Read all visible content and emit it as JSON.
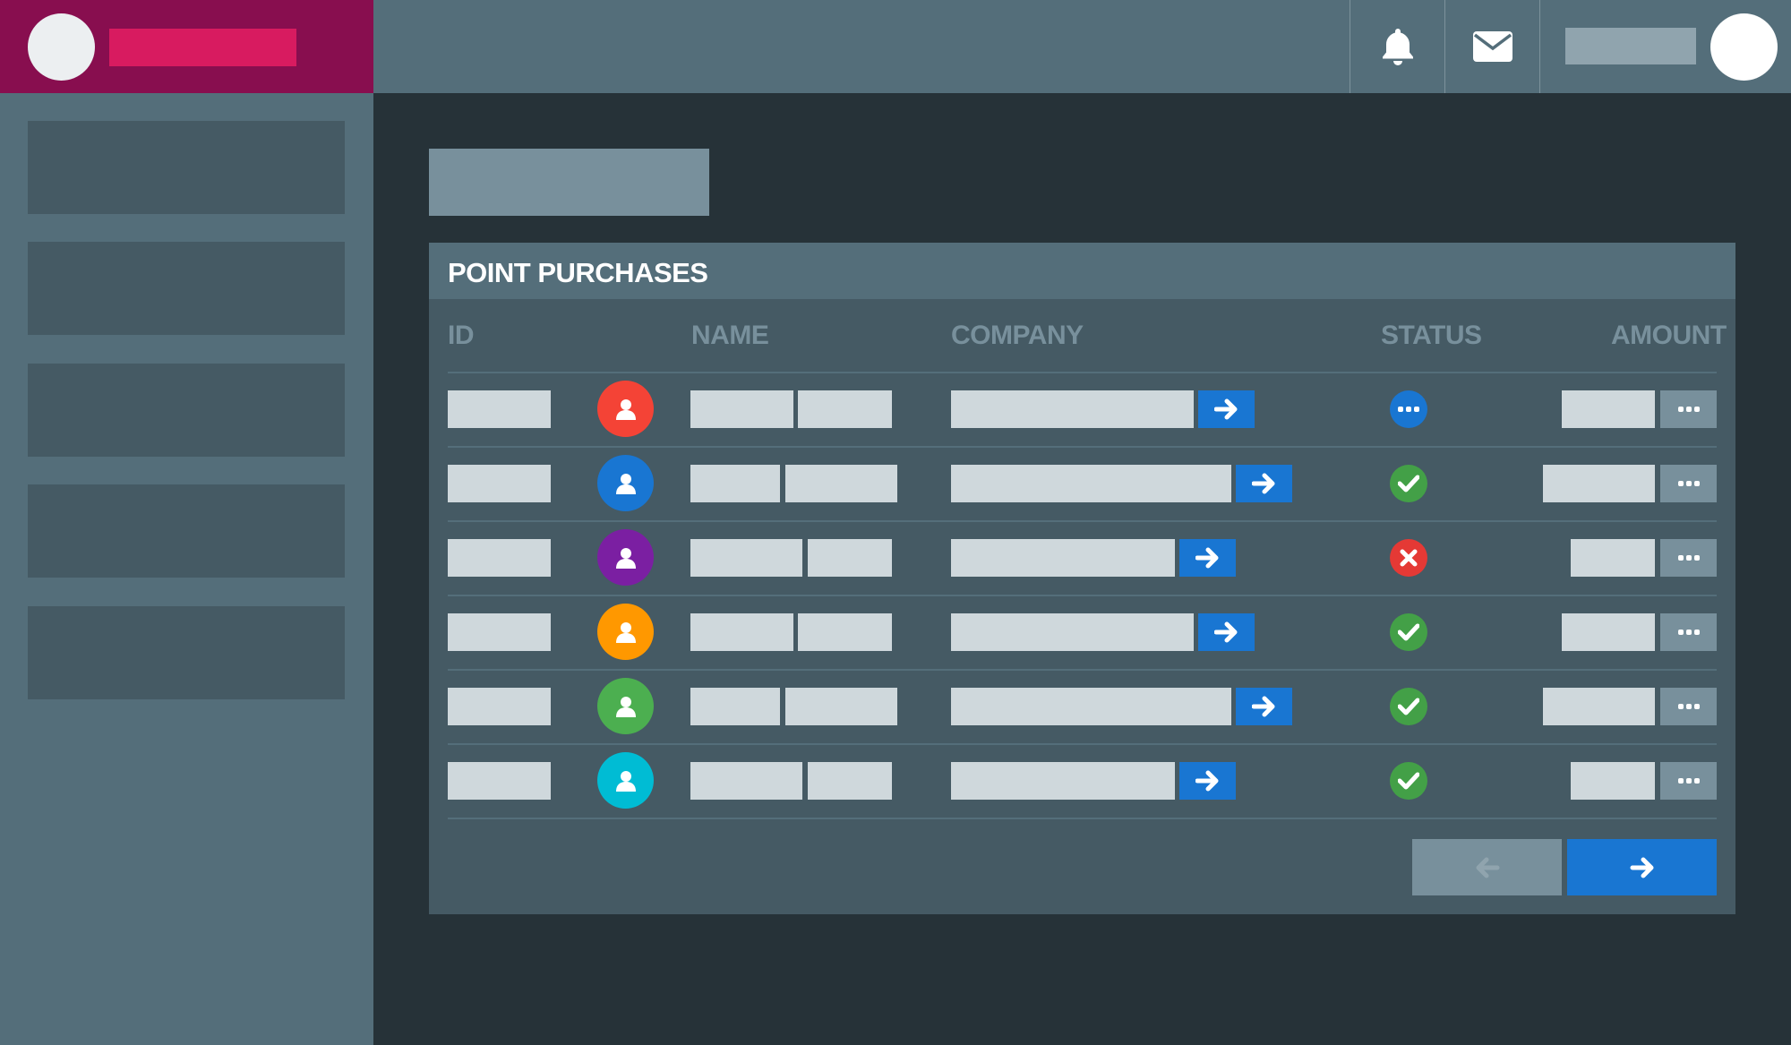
{
  "header": {
    "icons": {
      "notifications": "bell-icon",
      "messages": "mail-icon"
    }
  },
  "card": {
    "title": "POINT PURCHASES",
    "columns": {
      "id": "ID",
      "name": "NAME",
      "company": "COMPANY",
      "status": "STATUS",
      "amount": "AMOUNT"
    }
  },
  "rows": [
    {
      "avatar_color": "#f44336",
      "status": "pending",
      "status_color": "#1976d2"
    },
    {
      "avatar_color": "#1976d2",
      "status": "approved",
      "status_color": "#43a047"
    },
    {
      "avatar_color": "#7b1fa2",
      "status": "rejected",
      "status_color": "#e53935"
    },
    {
      "avatar_color": "#ff9800",
      "status": "approved",
      "status_color": "#43a047"
    },
    {
      "avatar_color": "#4caf50",
      "status": "approved",
      "status_color": "#43a047"
    },
    {
      "avatar_color": "#00bcd4",
      "status": "approved",
      "status_color": "#43a047"
    }
  ],
  "pagination": {
    "prev_icon": "arrow-left-icon",
    "next_icon": "arrow-right-icon"
  },
  "colors": {
    "brand": "#880e4f",
    "accent": "#d81b60",
    "primary": "#1976d2"
  }
}
